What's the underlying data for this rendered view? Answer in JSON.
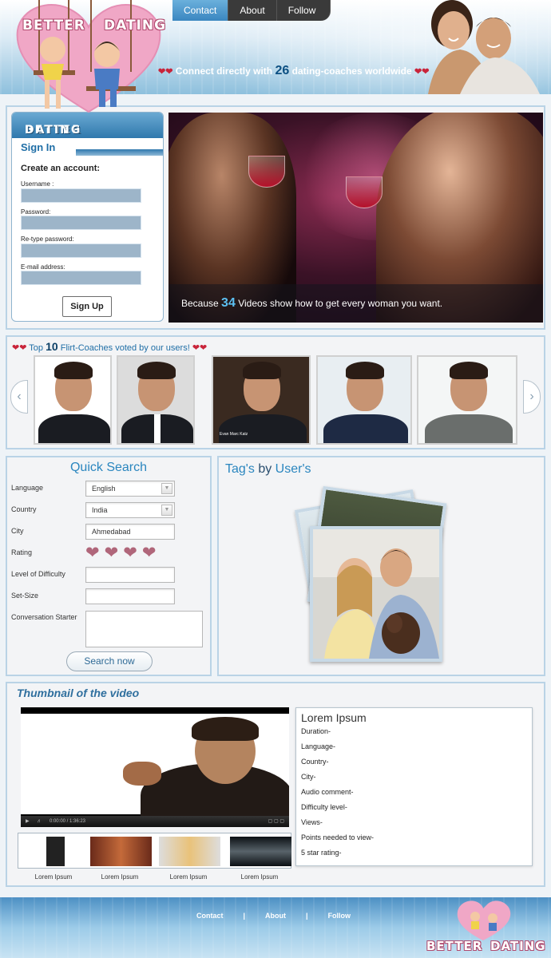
{
  "brand": {
    "word1": "BETTER",
    "word2": "DATING"
  },
  "nav": {
    "items": [
      "Contact",
      "About",
      "Follow"
    ]
  },
  "tagline": {
    "before": "Connect directly with",
    "count": "26",
    "after": "dating-coaches worldwide"
  },
  "signin": {
    "tab": "Sign In",
    "title": "Create an account:",
    "labels": [
      "Username :",
      "Password:",
      "Re-type password:",
      "E-mail address:"
    ],
    "button": "Sign Up"
  },
  "hero": {
    "before": "Because",
    "count": "34",
    "after": "Videos show how to get every woman you want."
  },
  "coaches": {
    "before": "Top",
    "count": "10",
    "after": "Flirt-Coaches voted by our users!",
    "badge_text": "Evan Marc Katz"
  },
  "quick_search": {
    "title": "Quick Search",
    "labels": [
      "Language",
      "Country",
      "City",
      "Rating",
      "Level of Difficulty",
      "Set-Size",
      "Conversation Starter"
    ],
    "language": "English",
    "country": "India",
    "city": "Ahmedabad",
    "rating": 4,
    "button": "Search now"
  },
  "tags": {
    "part1": "Tag's",
    "part2": "by",
    "part3": "User's"
  },
  "thumbnail": {
    "title": "Thumbnail of the video",
    "time": "0:00:00 / 1:36:23",
    "strip_labels": [
      "Lorem Ipsum",
      "Lorem Ipsum",
      "Lorem Ipsum",
      "Lorem Ipsum"
    ],
    "info_title": "Lorem Ipsum",
    "info_rows": [
      "Duration-",
      "Language-",
      "Country-",
      "City-",
      "Audio comment-",
      "Difficulty level-",
      "Views-",
      "Points needed to view-",
      "5 star rating-"
    ]
  },
  "footer": {
    "links": [
      "Contact",
      "|",
      "About",
      "|",
      "Follow"
    ]
  },
  "colors": {
    "accent": "#2a86bf",
    "heart": "#c9243a",
    "nav_active": "#3a86c0"
  }
}
